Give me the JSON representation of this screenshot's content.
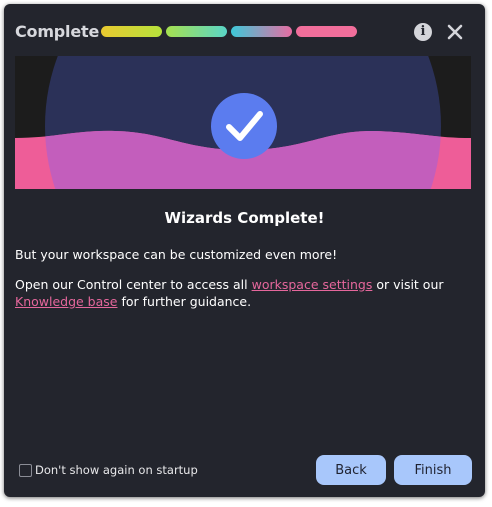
{
  "window": {
    "title": "Complete",
    "info_icon": "info-icon",
    "info_glyph": "i",
    "close_icon": "close-icon"
  },
  "progress": {
    "steps": [
      {
        "gradient": [
          "#e9c930",
          "#b6e23c"
        ],
        "completed": true
      },
      {
        "gradient": [
          "#a6e04f",
          "#5ad6c8"
        ],
        "completed": true
      },
      {
        "gradient": [
          "#3ec8d8",
          "#e66da2"
        ],
        "completed": true
      },
      {
        "gradient": [
          "#f16e9b",
          "#f16e9b"
        ],
        "completed": true
      }
    ]
  },
  "banner": {
    "icon": "checkmark-icon",
    "colors": {
      "background": "#1c1c1c",
      "circle": "#2b3158",
      "wave": "#c35ebc",
      "wave_edge": "#ee5d98",
      "check_circle": "#5b7cef",
      "check_mark": "#ffffff"
    }
  },
  "content": {
    "heading": "Wizards Complete!",
    "line1": "But your workspace can be customized even more!",
    "line2_part1": "Open our Control center to access all ",
    "line2_link1": "workspace settings",
    "line2_part2": " or visit our ",
    "line2_link2": "Knowledge base",
    "line2_part3": " for further guidance."
  },
  "footer": {
    "checkbox_label": "Don't show again on startup",
    "checkbox_checked": false,
    "back_label": "Back",
    "finish_label": "Finish"
  },
  "colors": {
    "dialog_bg": "#23252d",
    "link": "#e5679c",
    "button_bg": "#a8c7fb"
  }
}
